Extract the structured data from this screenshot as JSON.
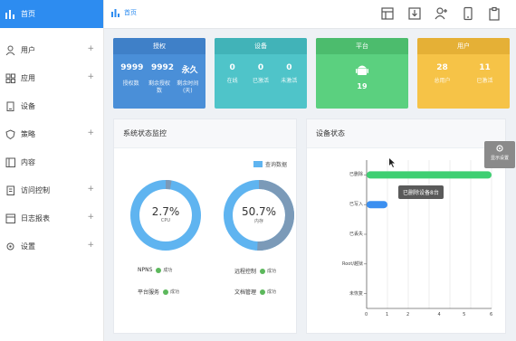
{
  "sidebar": {
    "items": [
      {
        "label": "首页",
        "icon": "bar-chart-icon",
        "active": true,
        "expandable": false
      },
      {
        "label": "用户",
        "icon": "user-icon",
        "active": false,
        "expandable": true
      },
      {
        "label": "应用",
        "icon": "grid-icon",
        "active": false,
        "expandable": true
      },
      {
        "label": "设备",
        "icon": "device-icon",
        "active": false,
        "expandable": false
      },
      {
        "label": "策略",
        "icon": "shield-icon",
        "active": false,
        "expandable": true
      },
      {
        "label": "内容",
        "icon": "content-icon",
        "active": false,
        "expandable": false
      },
      {
        "label": "访问控制",
        "icon": "access-icon",
        "active": false,
        "expandable": true
      },
      {
        "label": "日志报表",
        "icon": "report-icon",
        "active": false,
        "expandable": true
      },
      {
        "label": "设置",
        "icon": "gear-icon",
        "active": false,
        "expandable": true
      }
    ]
  },
  "header": {
    "breadcrumb": "首页"
  },
  "cards": [
    {
      "title": "授权",
      "color": "#4a8fd8",
      "header_color": "#3f80c8",
      "values": [
        "9999",
        "9992",
        "永久"
      ],
      "labels": [
        "授权数",
        "剩余授权数",
        "剩余时间(天)"
      ]
    },
    {
      "title": "设备",
      "color": "#4fc4c9",
      "header_color": "#41b3b8",
      "values": [
        "0",
        "0",
        "0"
      ],
      "labels": [
        "在线",
        "已激活",
        "未激活"
      ]
    },
    {
      "title": "平台",
      "color": "#5bd07f",
      "header_color": "#4cbc6d",
      "values": [
        "19"
      ],
      "labels": []
    },
    {
      "title": "用户",
      "color": "#f6c347",
      "header_color": "#e5b036",
      "values": [
        "28",
        "11"
      ],
      "labels": [
        "总用户",
        "已激活"
      ]
    }
  ],
  "system_panel": {
    "title": "系统状态监控",
    "legend": "查询数据",
    "cpu": {
      "value": "2.7%",
      "label": "CPU",
      "percent": 2.7
    },
    "mem": {
      "value": "50.7%",
      "label": "内存",
      "percent": 50.7
    },
    "services": [
      {
        "name": "NPNS",
        "status": "成功"
      },
      {
        "name": "远程控制",
        "status": "成功"
      },
      {
        "name": "平台服务",
        "status": "成功"
      },
      {
        "name": "文档管理",
        "status": "成功"
      }
    ]
  },
  "device_panel": {
    "title": "设备状态",
    "hint": "显示设置",
    "tooltip": "已删除设备8台"
  },
  "chart_data": {
    "type": "bar",
    "orientation": "horizontal",
    "categories": [
      "已删除",
      "已写入",
      "已丢失",
      "Root/越狱",
      "未恢复"
    ],
    "values": [
      6,
      1,
      0,
      0,
      0
    ],
    "xlim": [
      0,
      6
    ],
    "xticks": [
      "0",
      "1",
      "2",
      "4",
      "5",
      "6"
    ],
    "colors": [
      "#3ecf72",
      "#3b8ff0"
    ],
    "grid": true
  }
}
